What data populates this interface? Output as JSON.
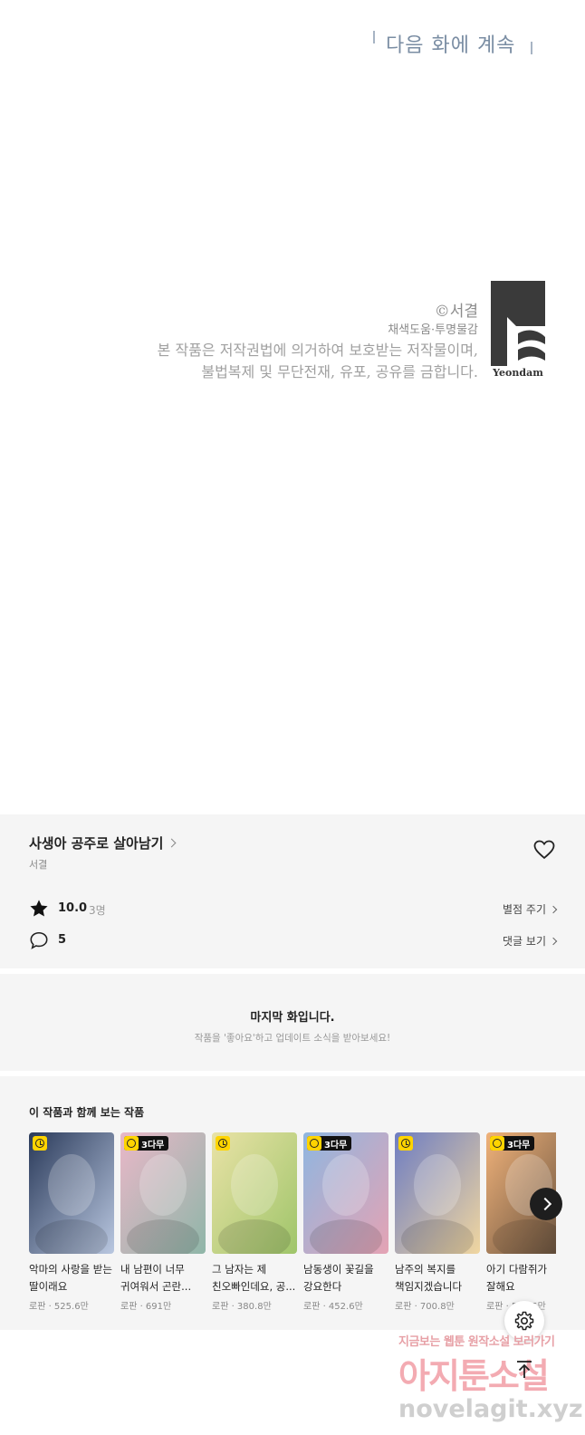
{
  "comic": {
    "next_episode_text": "다음 화에 계속",
    "credit": {
      "copyright": "©서결",
      "staff": "채색도움·투명물감",
      "notice_line1": "본 작품은 저작권법에 의거하여 보호받는 저작물이며,",
      "notice_line2": "불법복제 및 무단전재, 유포, 공유를 금합니다.",
      "logo_text": "Yeondam"
    }
  },
  "series": {
    "title": "사생아 공주로 살아남기",
    "author": "서결",
    "rating": "10.0",
    "rating_count": "3명",
    "rate_link": "별점 주기",
    "comment_count": "5",
    "comment_link": "댓글 보기"
  },
  "last_episode": {
    "title": "마지막 화입니다.",
    "subtitle": "작품을 '좋아요'하고 업데이트 소식을 받아보세요!"
  },
  "recommendations": {
    "heading": "이 작품과 함께 보는 작품",
    "items": [
      {
        "title": "악마의 사랑을 받는 딸이래요",
        "meta": "로판 · 525.6만",
        "badge": "",
        "colors": [
          "#2a3a5a",
          "#b9c7e0"
        ]
      },
      {
        "title": "내 남편이 너무 귀여워서 곤란...",
        "meta": "로판 · 691만",
        "badge": "3다무",
        "colors": [
          "#e9b7c8",
          "#8fb6a8"
        ]
      },
      {
        "title": "그 남자는 제 친오빠인데요, 공...",
        "meta": "로판 · 380.8만",
        "badge": "",
        "colors": [
          "#e9e2a6",
          "#9fc56a"
        ]
      },
      {
        "title": "남동생이 꽃길을 강요한다",
        "meta": "로판 · 452.6만",
        "badge": "3다무",
        "colors": [
          "#8fb6e0",
          "#e4a3b4"
        ]
      },
      {
        "title": "남주의 복지를 책임지겠습니다",
        "meta": "로판 · 700.8만",
        "badge": "",
        "colors": [
          "#6e7dc2",
          "#f0d6a0"
        ]
      },
      {
        "title": "아기 다람쥐가 잘해요",
        "meta": "로판 · 562.5만",
        "badge": "3다무",
        "colors": [
          "#f0b27a",
          "#5e4b3a"
        ]
      }
    ]
  },
  "watermark": {
    "line1": "지금보는 웹툰 원작소설 보러가기",
    "line2": "아지툰소설",
    "line3": "novelagit.xyz"
  },
  "icons": {
    "star": "star-icon",
    "comment": "comment-bubble-icon",
    "heart": "heart-icon",
    "settings": "gear-icon",
    "scroll_top": "arrow-up-to-top-icon",
    "next": "chevron-right-icon"
  },
  "colors": {
    "badge_yellow": "#ffd400",
    "section_bg": "#f5f5f5",
    "next_episode_text": "#7a8da3"
  }
}
